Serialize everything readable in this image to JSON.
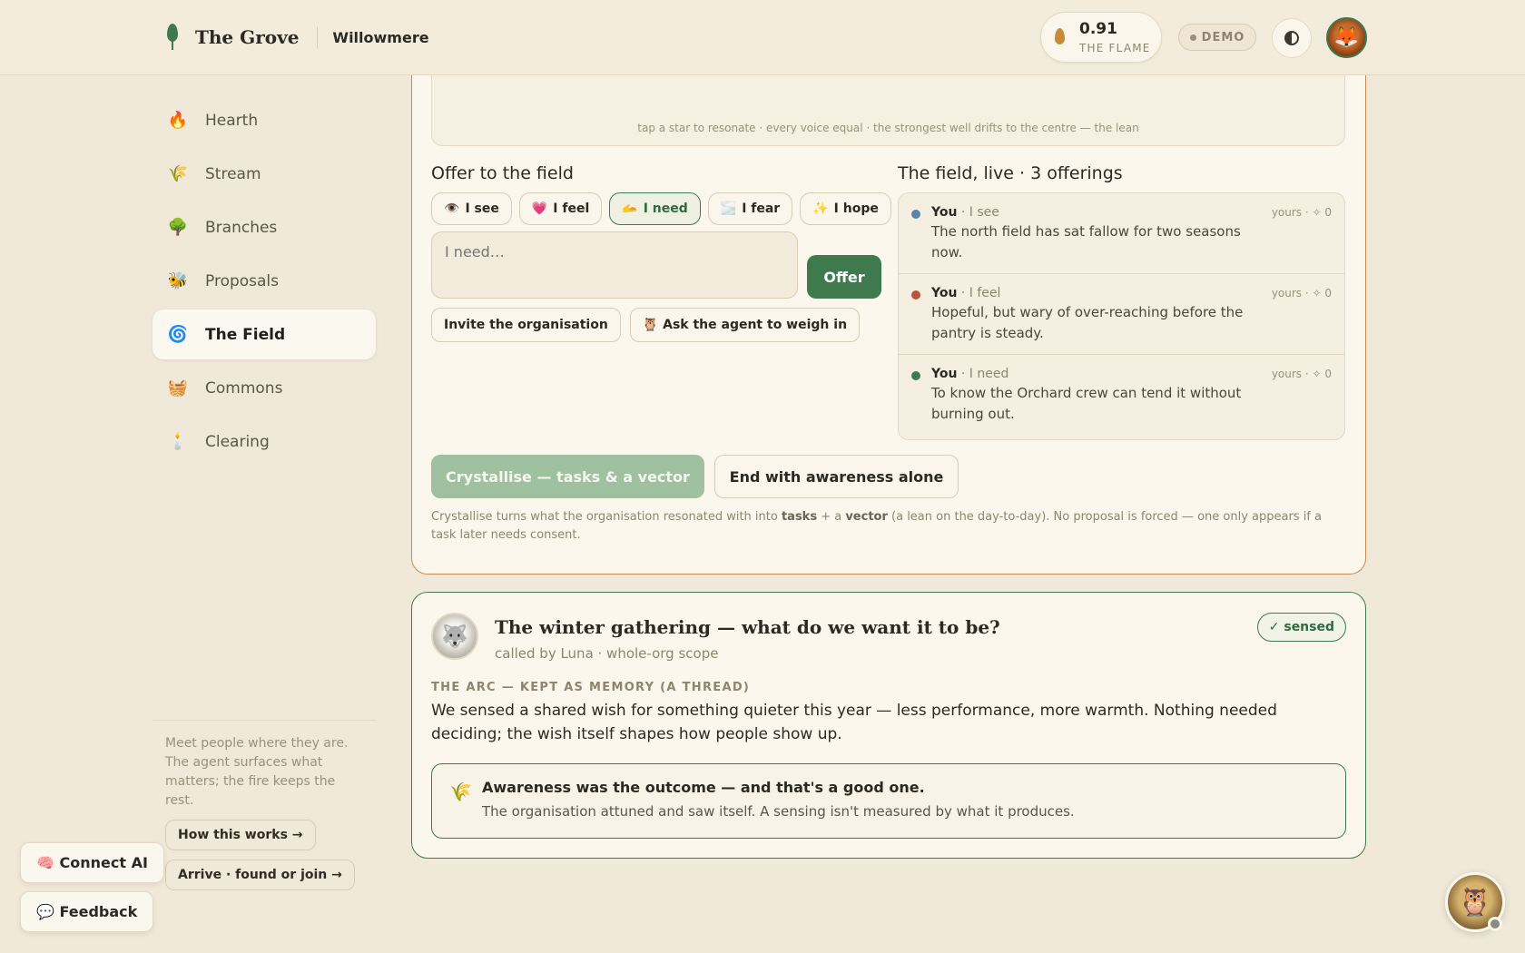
{
  "header": {
    "brand": "The Grove",
    "org": "Willowmere",
    "flame_value": "0.91",
    "flame_label": "THE FLAME",
    "demo_label": "DEMO"
  },
  "sidebar": {
    "items": [
      {
        "label": "Hearth",
        "icon": "🔥"
      },
      {
        "label": "Stream",
        "icon": "🌾"
      },
      {
        "label": "Branches",
        "icon": "🌳"
      },
      {
        "label": "Proposals",
        "icon": "🐝"
      },
      {
        "label": "The Field",
        "icon": "🌀",
        "active": true
      },
      {
        "label": "Commons",
        "icon": "🧺"
      },
      {
        "label": "Clearing",
        "icon": "🕯️"
      }
    ],
    "footer_text": "Meet people where they are. The agent surfaces what matters; the fire keeps the rest.",
    "how_label": "How this works →",
    "arrive_label": "Arrive · found or join →"
  },
  "floating": {
    "connect_ai": "🧠 Connect AI",
    "feedback": "💬 Feedback"
  },
  "field_card": {
    "star_caption": "tap a star to resonate · every voice equal · the strongest well drifts to the centre — the lean",
    "offer_title": "Offer to the field",
    "chips": [
      {
        "icon": "👁️",
        "label": "I see"
      },
      {
        "icon": "💗",
        "label": "I feel"
      },
      {
        "icon": "🫴",
        "label": "I need",
        "selected": true
      },
      {
        "icon": "🌫️",
        "label": "I fear"
      },
      {
        "icon": "✨",
        "label": "I hope"
      }
    ],
    "input_placeholder": "I need…",
    "offer_button": "Offer",
    "invite_button": "Invite the organisation",
    "ask_agent_button": "🦉 Ask the agent to weigh in",
    "field_title": "The field, live · 3 offerings",
    "offerings": [
      {
        "who": "You",
        "kind": " · I see",
        "meta": "yours · ✧ 0",
        "text": "The north field has sat fallow for two seasons now.",
        "color": "#5b83a8"
      },
      {
        "who": "You",
        "kind": " · I feel",
        "meta": "yours · ✧ 0",
        "text": "Hopeful, but wary of over-reaching before the pantry is steady.",
        "color": "#b8553a"
      },
      {
        "who": "You",
        "kind": " · I need",
        "meta": "yours · ✧ 0",
        "text": "To know the Orchard crew can tend it without burning out.",
        "color": "#3f7a4f"
      }
    ],
    "crystallise_button": "Crystallise — tasks & a vector",
    "end_button": "End with awareness alone",
    "note_pre": "Crystallise turns what the organisation resonated with into ",
    "note_tasks": "tasks",
    "note_mid": " + a ",
    "note_vector": "vector",
    "note_post": " (a lean on the day-to-day). No proposal is forced — one only appears if a task later needs consent."
  },
  "gathering_card": {
    "title": "The winter gathering — what do we want it to be?",
    "subtitle": "called by Luna · whole-org scope",
    "sensed_badge": "✓ sensed",
    "arc_label": "THE ARC — KEPT AS MEMORY (A THREAD)",
    "arc_text": "We sensed a shared wish for something quieter this year — less performance, more warmth. Nothing needed deciding; the wish itself shapes how people show up.",
    "aware_icon": "🌾",
    "aware_title": "Awareness was the outcome — and that's a good one.",
    "aware_text": "The organisation attuned and saw itself. A sensing isn't measured by what it produces."
  }
}
